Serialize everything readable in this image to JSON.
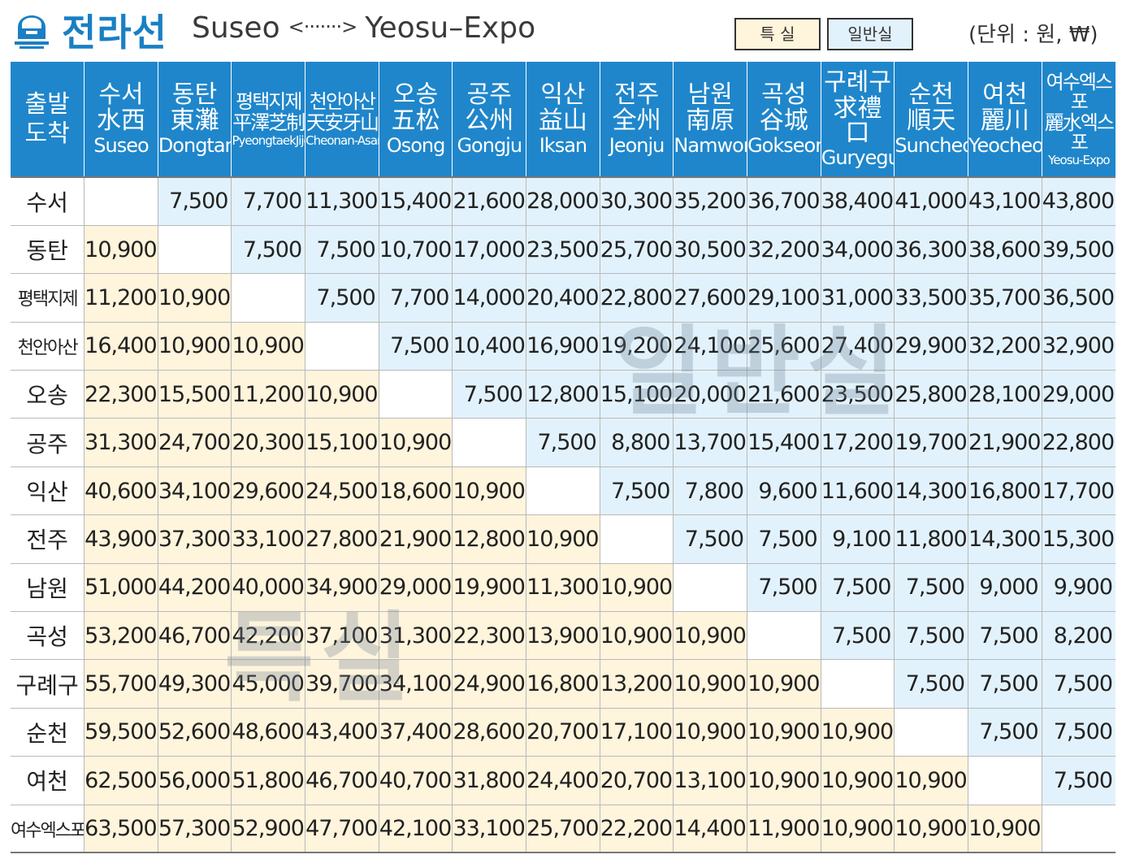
{
  "header": {
    "line_name": "전라선",
    "origin": "Suseo",
    "arrow": "<·······>",
    "destination": "Yeosu–Expo",
    "legend_special": "특 실",
    "legend_general": "일반실",
    "unit_note": "(단위 : 원, ₩)"
  },
  "colors": {
    "header_blue": "#1f86cb",
    "special_class_bg": "#fff4dc",
    "general_class_bg": "#e2f2fc",
    "title_blue": "#1a7fc4"
  },
  "icons": {
    "logo": "train-front-icon"
  },
  "table": {
    "corner": [
      "출발",
      "도착"
    ],
    "columns": [
      {
        "ko": "수서",
        "cn": "水西",
        "en": "Suseo"
      },
      {
        "ko": "동탄",
        "cn": "東灘",
        "en": "Dongtan"
      },
      {
        "ko": "평택지제",
        "cn": "平澤芝制",
        "en": "PyeongtaekJije"
      },
      {
        "ko": "천안아산",
        "cn": "天安牙山",
        "en": "Cheonan-Asan"
      },
      {
        "ko": "오송",
        "cn": "五松",
        "en": "Osong"
      },
      {
        "ko": "공주",
        "cn": "公州",
        "en": "Gongju"
      },
      {
        "ko": "익산",
        "cn": "益山",
        "en": "Iksan"
      },
      {
        "ko": "전주",
        "cn": "全州",
        "en": "Jeonju"
      },
      {
        "ko": "남원",
        "cn": "南原",
        "en": "Namwon"
      },
      {
        "ko": "곡성",
        "cn": "谷城",
        "en": "Gokseong"
      },
      {
        "ko": "구례구",
        "cn": "求禮口",
        "en": "Guryegu"
      },
      {
        "ko": "순천",
        "cn": "順天",
        "en": "Suncheon"
      },
      {
        "ko": "여천",
        "cn": "麗川",
        "en": "Yeocheon"
      },
      {
        "ko": "여수엑스포",
        "cn": "麗水엑스포",
        "en": "Yeosu-Expo"
      }
    ],
    "rows": [
      {
        "station": "수서",
        "fares": [
          "",
          "7,500",
          "7,700",
          "11,300",
          "15,400",
          "21,600",
          "28,000",
          "30,300",
          "35,200",
          "36,700",
          "38,400",
          "41,000",
          "43,100",
          "43,800"
        ]
      },
      {
        "station": "동탄",
        "fares": [
          "10,900",
          "",
          "7,500",
          "7,500",
          "10,700",
          "17,000",
          "23,500",
          "25,700",
          "30,500",
          "32,200",
          "34,000",
          "36,300",
          "38,600",
          "39,500"
        ]
      },
      {
        "station": "평택지제",
        "fares": [
          "11,200",
          "10,900",
          "",
          "7,500",
          "7,700",
          "14,000",
          "20,400",
          "22,800",
          "27,600",
          "29,100",
          "31,000",
          "33,500",
          "35,700",
          "36,500"
        ]
      },
      {
        "station": "천안아산",
        "fares": [
          "16,400",
          "10,900",
          "10,900",
          "",
          "7,500",
          "10,400",
          "16,900",
          "19,200",
          "24,100",
          "25,600",
          "27,400",
          "29,900",
          "32,200",
          "32,900"
        ]
      },
      {
        "station": "오송",
        "fares": [
          "22,300",
          "15,500",
          "11,200",
          "10,900",
          "",
          "7,500",
          "12,800",
          "15,100",
          "20,000",
          "21,600",
          "23,500",
          "25,800",
          "28,100",
          "29,000"
        ]
      },
      {
        "station": "공주",
        "fares": [
          "31,300",
          "24,700",
          "20,300",
          "15,100",
          "10,900",
          "",
          "7,500",
          "8,800",
          "13,700",
          "15,400",
          "17,200",
          "19,700",
          "21,900",
          "22,800"
        ]
      },
      {
        "station": "익산",
        "fares": [
          "40,600",
          "34,100",
          "29,600",
          "24,500",
          "18,600",
          "10,900",
          "",
          "7,500",
          "7,800",
          "9,600",
          "11,600",
          "14,300",
          "16,800",
          "17,700"
        ]
      },
      {
        "station": "전주",
        "fares": [
          "43,900",
          "37,300",
          "33,100",
          "27,800",
          "21,900",
          "12,800",
          "10,900",
          "",
          "7,500",
          "7,500",
          "9,100",
          "11,800",
          "14,300",
          "15,300"
        ]
      },
      {
        "station": "남원",
        "fares": [
          "51,000",
          "44,200",
          "40,000",
          "34,900",
          "29,000",
          "19,900",
          "11,300",
          "10,900",
          "",
          "7,500",
          "7,500",
          "7,500",
          "9,000",
          "9,900"
        ]
      },
      {
        "station": "곡성",
        "fares": [
          "53,200",
          "46,700",
          "42,200",
          "37,100",
          "31,300",
          "22,300",
          "13,900",
          "10,900",
          "10,900",
          "",
          "7,500",
          "7,500",
          "7,500",
          "8,200"
        ]
      },
      {
        "station": "구례구",
        "fares": [
          "55,700",
          "49,300",
          "45,000",
          "39,700",
          "34,100",
          "24,900",
          "16,800",
          "13,200",
          "10,900",
          "10,900",
          "",
          "7,500",
          "7,500",
          "7,500"
        ]
      },
      {
        "station": "순천",
        "fares": [
          "59,500",
          "52,600",
          "48,600",
          "43,400",
          "37,400",
          "28,600",
          "20,700",
          "17,100",
          "10,900",
          "10,900",
          "10,900",
          "",
          "7,500",
          "7,500"
        ]
      },
      {
        "station": "여천",
        "fares": [
          "62,500",
          "56,000",
          "51,800",
          "46,700",
          "40,700",
          "31,800",
          "24,400",
          "20,700",
          "13,100",
          "10,900",
          "10,900",
          "10,900",
          "",
          "7,500"
        ]
      },
      {
        "station": "여수엑스포",
        "fares": [
          "63,500",
          "57,300",
          "52,900",
          "47,700",
          "42,100",
          "33,100",
          "25,700",
          "22,200",
          "14,400",
          "11,900",
          "10,900",
          "10,900",
          "10,900",
          ""
        ]
      }
    ]
  },
  "watermarks": {
    "general": "일반실",
    "special": "특실"
  }
}
